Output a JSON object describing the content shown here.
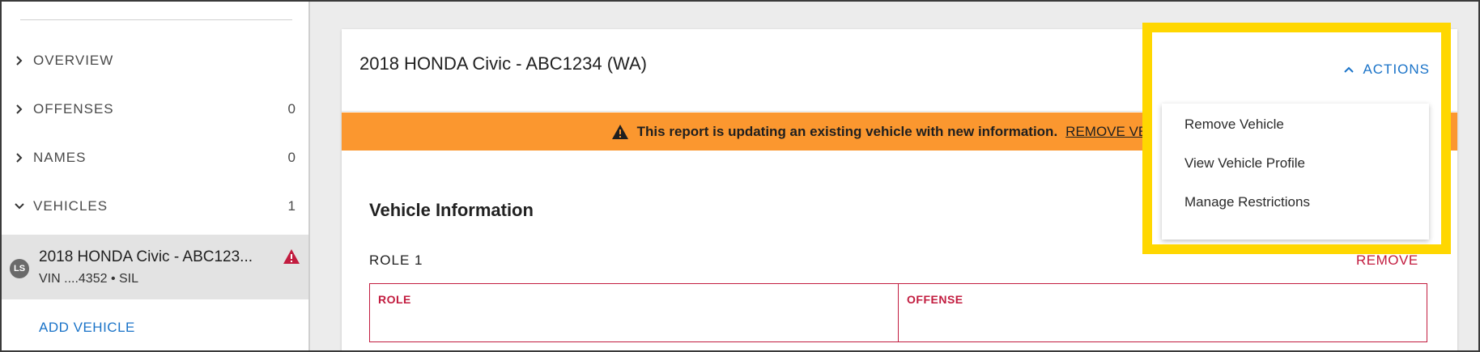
{
  "sidebar": {
    "items": [
      {
        "label": "OVERVIEW",
        "count": ""
      },
      {
        "label": "OFFENSES",
        "count": "0"
      },
      {
        "label": "NAMES",
        "count": "0"
      },
      {
        "label": "VEHICLES",
        "count": "1"
      }
    ],
    "vehicle": {
      "avatar": "LS",
      "title": "2018 HONDA Civic - ABC123...",
      "subtitle": "VIN ....4352 • SIL",
      "warning_icon": "warning-icon"
    },
    "add_vehicle": "ADD VEHICLE"
  },
  "card": {
    "title": "2018 HONDA Civic - ABC1234 (WA)",
    "banner": {
      "text": "This report is updating an existing vehicle with new information.",
      "link": "REMOVE VEHICLE",
      "color": "#fb972f"
    },
    "section_title": "Vehicle Information",
    "role_heading": "ROLE 1",
    "remove": "REMOVE",
    "table": {
      "columns": [
        "ROLE",
        "OFFENSE"
      ]
    }
  },
  "actions": {
    "label": "ACTIONS",
    "menu": [
      "Remove Vehicle",
      "View Vehicle Profile",
      "Manage Restrictions"
    ]
  },
  "colors": {
    "accent_blue": "#1a73c8",
    "error_red": "#c21c3f",
    "highlight_yellow": "#ffd700"
  }
}
